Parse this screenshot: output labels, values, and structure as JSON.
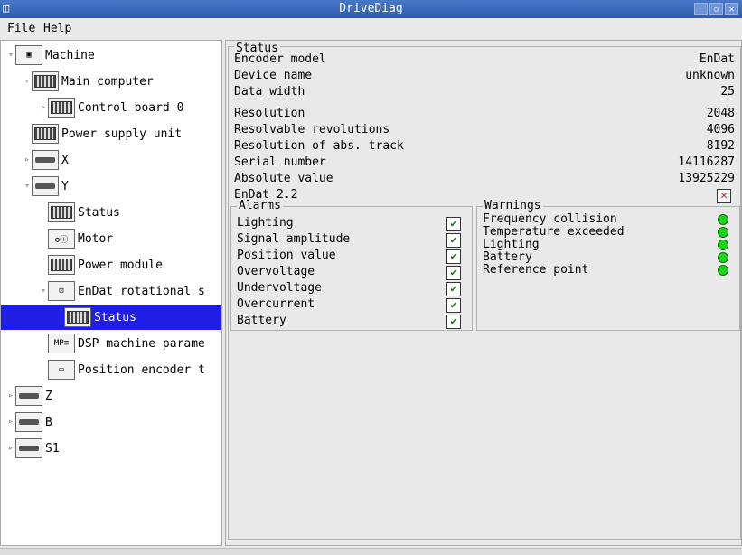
{
  "window": {
    "title": "DriveDiag",
    "icon": "cube-icon"
  },
  "menu": {
    "file": "File",
    "help": "Help"
  },
  "tree": [
    {
      "label": "Machine",
      "icon": "machine-icon",
      "arrow": "▿",
      "indent": 0,
      "selected": false
    },
    {
      "label": "Main computer",
      "icon": "rack-icon",
      "arrow": "▿",
      "indent": 1,
      "selected": false
    },
    {
      "label": "Control board 0",
      "icon": "rack-icon",
      "arrow": "▹",
      "indent": 2,
      "selected": false
    },
    {
      "label": "Power supply unit",
      "icon": "rack-icon",
      "arrow": "",
      "indent": 1,
      "selected": false
    },
    {
      "label": "X",
      "icon": "axis-icon",
      "arrow": "▹",
      "indent": 1,
      "selected": false
    },
    {
      "label": "Y",
      "icon": "axis-icon",
      "arrow": "▿",
      "indent": 1,
      "selected": false
    },
    {
      "label": "Status",
      "icon": "status-icon",
      "arrow": "",
      "indent": 2,
      "selected": false
    },
    {
      "label": "Motor",
      "icon": "motor-info-icon",
      "arrow": "",
      "indent": 2,
      "selected": false
    },
    {
      "label": "Power module",
      "icon": "module-info-icon",
      "arrow": "",
      "indent": 2,
      "selected": false
    },
    {
      "label": "EnDat rotational s",
      "icon": "endat-icon",
      "arrow": "▿",
      "indent": 2,
      "selected": false
    },
    {
      "label": "Status",
      "icon": "status-icon",
      "arrow": "",
      "indent": 3,
      "selected": true
    },
    {
      "label": "DSP machine parame",
      "icon": "mp-icon",
      "arrow": "",
      "indent": 2,
      "selected": false
    },
    {
      "label": "Position encoder t",
      "icon": "encoder-icon",
      "arrow": "",
      "indent": 2,
      "selected": false
    },
    {
      "label": "Z",
      "icon": "axis-icon",
      "arrow": "▹",
      "indent": 0,
      "selected": false
    },
    {
      "label": "B",
      "icon": "axis-icon",
      "arrow": "▹",
      "indent": 0,
      "selected": false
    },
    {
      "label": "S1",
      "icon": "axis-icon",
      "arrow": "▹",
      "indent": 0,
      "selected": false
    }
  ],
  "status": {
    "title": "Status",
    "rows": [
      {
        "label": "Encoder model",
        "value": "EnDat"
      },
      {
        "label": "Device name",
        "value": "unknown"
      },
      {
        "label": "Data width",
        "value": "25"
      },
      {
        "label": "Resolution",
        "value": "2048"
      },
      {
        "label": "Resolvable revolutions",
        "value": "4096"
      },
      {
        "label": "Resolution of abs. track",
        "value": "8192"
      },
      {
        "label": "Serial number",
        "value": "14116287"
      },
      {
        "label": "Absolute value",
        "value": "13925229"
      }
    ],
    "endat22": {
      "label": "EnDat 2.2",
      "state": "unchecked-x"
    }
  },
  "alarms": {
    "title": "Alarms",
    "items": [
      {
        "label": "Lighting",
        "ok": true
      },
      {
        "label": "Signal amplitude",
        "ok": true
      },
      {
        "label": "Position value",
        "ok": true
      },
      {
        "label": "Overvoltage",
        "ok": true
      },
      {
        "label": "Undervoltage",
        "ok": true
      },
      {
        "label": "Overcurrent",
        "ok": true
      },
      {
        "label": "Battery",
        "ok": true
      }
    ]
  },
  "warnings": {
    "title": "Warnings",
    "items": [
      {
        "label": "Frequency collision",
        "color": "#1ed31e"
      },
      {
        "label": "Temperature exceeded",
        "color": "#1ed31e"
      },
      {
        "label": "Lighting",
        "color": "#1ed31e"
      },
      {
        "label": "Battery",
        "color": "#1ed31e"
      },
      {
        "label": "Reference point",
        "color": "#1ed31e"
      }
    ]
  }
}
